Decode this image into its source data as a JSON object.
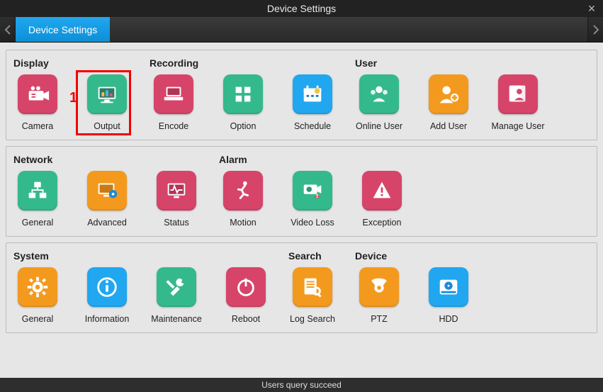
{
  "title": "Device Settings",
  "tab_label": "Device Settings",
  "statusbar": "Users query succeed",
  "annotations": {
    "highlight_number": "1"
  },
  "groups": {
    "display": {
      "title": "Display",
      "items": [
        {
          "id": "camera",
          "label": "Camera",
          "color": "c-pink",
          "icon": "camera"
        },
        {
          "id": "output",
          "label": "Output",
          "color": "c-green",
          "icon": "monitor",
          "highlighted": true
        }
      ]
    },
    "recording": {
      "title": "Recording",
      "items": [
        {
          "id": "encode",
          "label": "Encode",
          "color": "c-pink",
          "icon": "laptop"
        },
        {
          "id": "option",
          "label": "Option",
          "color": "c-green",
          "icon": "grid"
        },
        {
          "id": "schedule",
          "label": "Schedule",
          "color": "c-blue",
          "icon": "calendar"
        }
      ]
    },
    "user": {
      "title": "User",
      "items": [
        {
          "id": "online-user",
          "label": "Online User",
          "color": "c-green",
          "icon": "users"
        },
        {
          "id": "add-user",
          "label": "Add User",
          "color": "c-orange",
          "icon": "adduser"
        },
        {
          "id": "manage-user",
          "label": "Manage User",
          "color": "c-pink",
          "icon": "manageuser"
        }
      ]
    },
    "network": {
      "title": "Network",
      "items": [
        {
          "id": "net-general",
          "label": "General",
          "color": "c-green",
          "icon": "network"
        },
        {
          "id": "advanced",
          "label": "Advanced",
          "color": "c-orange",
          "icon": "gearmonitor"
        },
        {
          "id": "status",
          "label": "Status",
          "color": "c-pink",
          "icon": "statusmonitor"
        }
      ]
    },
    "alarm": {
      "title": "Alarm",
      "items": [
        {
          "id": "motion",
          "label": "Motion",
          "color": "c-pink",
          "icon": "run"
        },
        {
          "id": "video-loss",
          "label": "Video Loss",
          "color": "c-green",
          "icon": "camwarn"
        },
        {
          "id": "exception",
          "label": "Exception",
          "color": "c-pink",
          "icon": "warn"
        }
      ]
    },
    "system": {
      "title": "System",
      "items": [
        {
          "id": "sys-general",
          "label": "General",
          "color": "c-orange",
          "icon": "gear"
        },
        {
          "id": "information",
          "label": "Information",
          "color": "c-blue",
          "icon": "info"
        },
        {
          "id": "maintenance",
          "label": "Maintenance",
          "color": "c-green",
          "icon": "tools"
        },
        {
          "id": "reboot",
          "label": "Reboot",
          "color": "c-pink",
          "icon": "power"
        }
      ]
    },
    "search": {
      "title": "Search",
      "items": [
        {
          "id": "log-search",
          "label": "Log Search",
          "color": "c-orange",
          "icon": "logsearch"
        }
      ]
    },
    "device": {
      "title": "Device",
      "items": [
        {
          "id": "ptz",
          "label": "PTZ",
          "color": "c-orange",
          "icon": "ptz"
        },
        {
          "id": "hdd",
          "label": "HDD",
          "color": "c-blue",
          "icon": "hdd"
        }
      ]
    }
  }
}
